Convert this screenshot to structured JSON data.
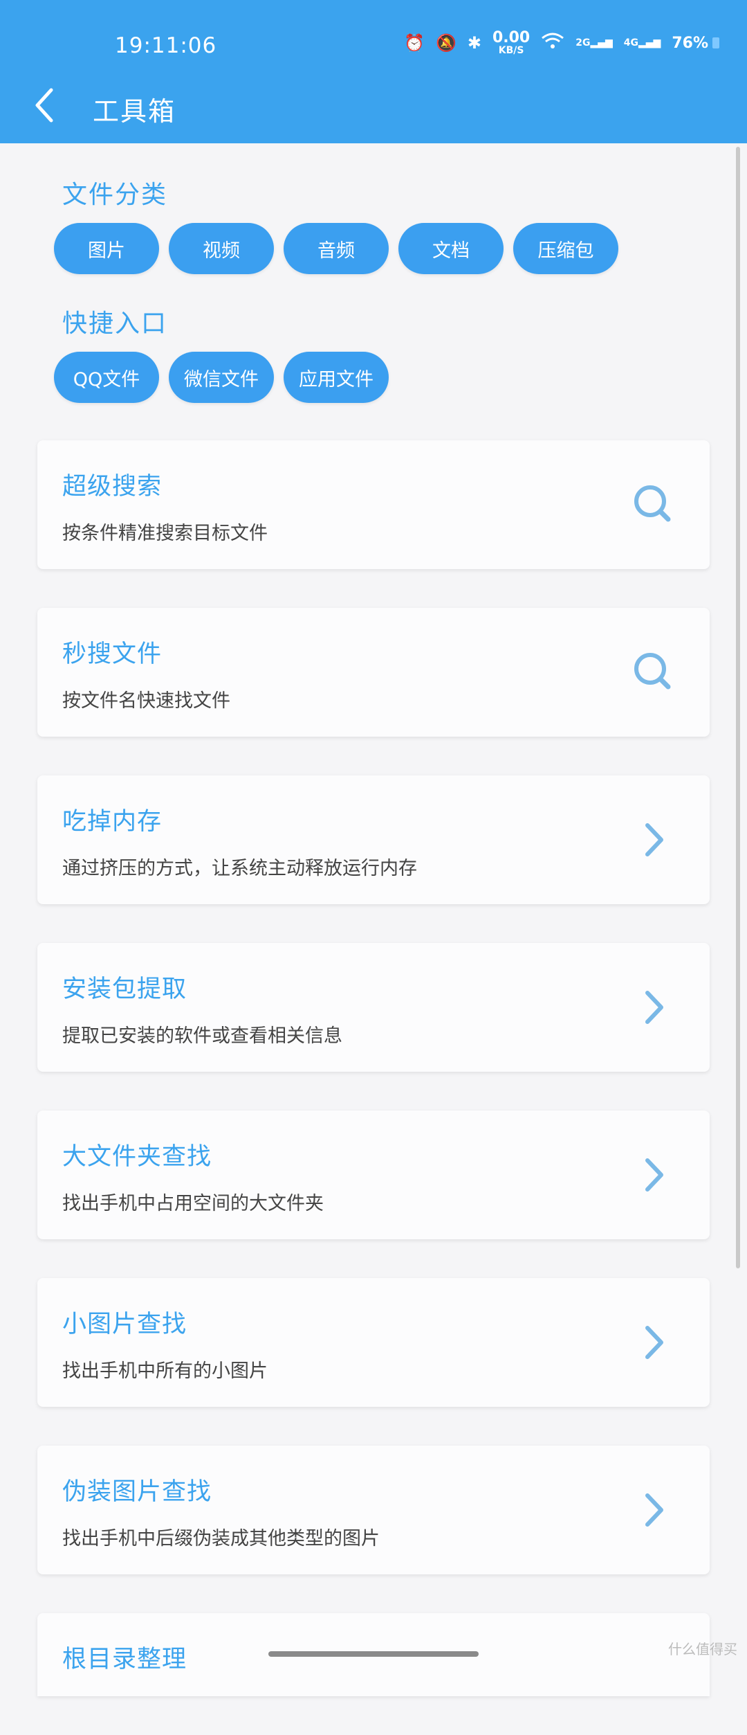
{
  "status_bar": {
    "time": "19:11:06",
    "net_speed_value": "0.00",
    "net_speed_unit": "KB/S",
    "signal1": "2G",
    "signal2": "4G",
    "battery": "76%"
  },
  "app_bar": {
    "title": "工具箱"
  },
  "file_categories": {
    "title": "文件分类",
    "chips": [
      "图片",
      "视频",
      "音频",
      "文档",
      "压缩包"
    ]
  },
  "quick_entry": {
    "title": "快捷入口",
    "chips": [
      "QQ文件",
      "微信文件",
      "应用文件"
    ]
  },
  "tools": [
    {
      "title": "超级搜索",
      "desc": "按条件精准搜索目标文件",
      "icon": "search-icon"
    },
    {
      "title": "秒搜文件",
      "desc": "按文件名快速找文件",
      "icon": "search-icon"
    },
    {
      "title": "吃掉内存",
      "desc": "通过挤压的方式，让系统主动释放运行内存",
      "icon": "chevron-right-icon"
    },
    {
      "title": "安装包提取",
      "desc": "提取已安装的软件或查看相关信息",
      "icon": "chevron-right-icon"
    },
    {
      "title": "大文件夹查找",
      "desc": "找出手机中占用空间的大文件夹",
      "icon": "chevron-right-icon"
    },
    {
      "title": "小图片查找",
      "desc": "找出手机中所有的小图片",
      "icon": "chevron-right-icon"
    },
    {
      "title": "伪装图片查找",
      "desc": "找出手机中后缀伪装成其他类型的图片",
      "icon": "chevron-right-icon"
    },
    {
      "title": "根目录整理",
      "desc": "",
      "icon": "chevron-right-icon"
    }
  ],
  "watermark": "什么值得买",
  "colors": {
    "accent": "#3ba3ee",
    "chip": "#3b9ff0",
    "icon": "#7ab8e6"
  }
}
